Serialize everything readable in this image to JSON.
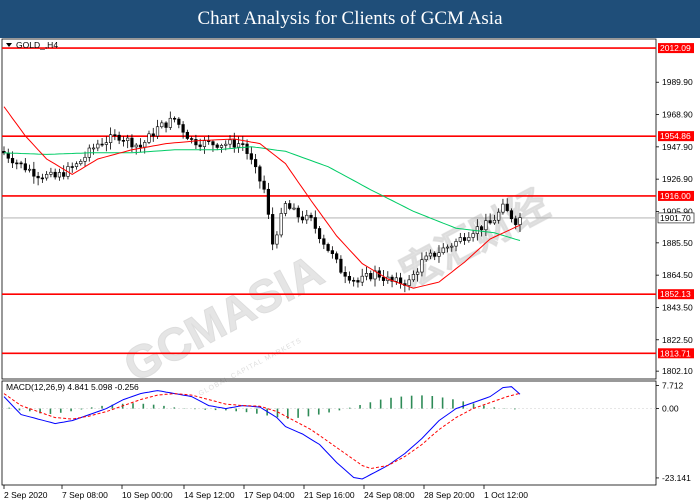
{
  "header": {
    "title": "Chart Analysis for Clients of GCM Asia"
  },
  "watermark": {
    "text": "GCMASIA",
    "chinese": "宏汇财经",
    "subtitle": "GLOBAL CAPITAL MARKETS"
  },
  "colors": {
    "header_bg": "#1f4e79",
    "level_line": "#ff0000",
    "current_price_line": "#a9a9a9",
    "ma_fast": "#ff0000",
    "ma_slow": "#00cc66",
    "macd_line": "#0000ff",
    "signal_line": "#ff0000",
    "histogram": "#2e8b57",
    "candle_outline": "#000000",
    "bull_candle": "#ffffff",
    "bear_candle": "#000000"
  },
  "chart_data": {
    "type": "candlestick",
    "symbol_label": "GOLD_,H4",
    "y_ticks": [
      "1989.90",
      "1968.90",
      "1947.90",
      "1926.90",
      "1905.90",
      "1885.50",
      "1864.50",
      "1843.50",
      "1822.50",
      "1802.10"
    ],
    "x_ticks": [
      "2 Sep 2020",
      "7 Sep 08:00",
      "10 Sep 00:00",
      "14 Sep 12:00",
      "17 Sep 04:00",
      "21 Sep 16:00",
      "24 Sep 08:00",
      "28 Sep 20:00",
      "1 Oct 12:00"
    ],
    "ylim": [
      1797,
      2018
    ],
    "levels": [
      {
        "label": "2012.09",
        "value": 2012.09
      },
      {
        "label": "1954.86",
        "value": 1954.86
      },
      {
        "label": "1916.00",
        "value": 1916.0
      },
      {
        "label": "1852.13",
        "value": 1852.13
      },
      {
        "label": "1813.71",
        "value": 1813.71
      }
    ],
    "current_price": {
      "label": "1901.70",
      "value": 1901.7
    },
    "close_path": [
      [
        0,
        1944
      ],
      [
        4,
        1936
      ],
      [
        8,
        1930
      ],
      [
        12,
        1928
      ],
      [
        17,
        1936
      ],
      [
        22,
        1950
      ],
      [
        27,
        1955
      ],
      [
        32,
        1948
      ],
      [
        36,
        1960
      ],
      [
        40,
        1966
      ],
      [
        44,
        1952
      ],
      [
        48,
        1950
      ],
      [
        52,
        1950
      ],
      [
        56,
        1950
      ],
      [
        61,
        1920
      ],
      [
        63,
        1885
      ],
      [
        66,
        1910
      ],
      [
        69,
        1903
      ],
      [
        72,
        1900
      ],
      [
        75,
        1886
      ],
      [
        79,
        1868
      ],
      [
        83,
        1860
      ],
      [
        87,
        1866
      ],
      [
        91,
        1860
      ],
      [
        95,
        1860
      ],
      [
        98,
        1873
      ],
      [
        102,
        1880
      ],
      [
        106,
        1886
      ],
      [
        110,
        1894
      ],
      [
        114,
        1898
      ],
      [
        117,
        1908
      ],
      [
        120,
        1900
      ],
      [
        121,
        1901.7
      ]
    ],
    "ma_slow_path": [
      [
        0,
        1944
      ],
      [
        10,
        1943
      ],
      [
        20,
        1944
      ],
      [
        30,
        1944
      ],
      [
        40,
        1946
      ],
      [
        50,
        1946
      ],
      [
        58,
        1948
      ],
      [
        66,
        1945
      ],
      [
        76,
        1935
      ],
      [
        86,
        1920
      ],
      [
        96,
        1906
      ],
      [
        106,
        1895
      ],
      [
        115,
        1892
      ],
      [
        121,
        1887
      ]
    ],
    "ma_fast_path": [
      [
        0,
        1974
      ],
      [
        5,
        1955
      ],
      [
        10,
        1940
      ],
      [
        16,
        1930
      ],
      [
        22,
        1940
      ],
      [
        30,
        1946
      ],
      [
        38,
        1950
      ],
      [
        46,
        1952
      ],
      [
        54,
        1953
      ],
      [
        60,
        1950
      ],
      [
        66,
        1937
      ],
      [
        72,
        1913
      ],
      [
        78,
        1890
      ],
      [
        84,
        1872
      ],
      [
        90,
        1862
      ],
      [
        96,
        1856
      ],
      [
        102,
        1860
      ],
      [
        108,
        1873
      ],
      [
        114,
        1888
      ],
      [
        121,
        1897
      ]
    ],
    "macd": {
      "label": "MACD(12,26,9) 4.841 5.098 -0.256",
      "y_ticks": [
        "7.712",
        "0.00",
        "-23.141"
      ],
      "ylim": [
        -25.5,
        9.2
      ],
      "macd_path": [
        [
          0,
          4
        ],
        [
          4,
          -2
        ],
        [
          8,
          -3.5
        ],
        [
          12,
          -5
        ],
        [
          16,
          -4
        ],
        [
          20,
          -2
        ],
        [
          24,
          0
        ],
        [
          28,
          3
        ],
        [
          32,
          5
        ],
        [
          36,
          6
        ],
        [
          40,
          5
        ],
        [
          44,
          4
        ],
        [
          48,
          1
        ],
        [
          52,
          0
        ],
        [
          56,
          1
        ],
        [
          60,
          0.5
        ],
        [
          64,
          -3
        ],
        [
          66,
          -6
        ],
        [
          70,
          -8.5
        ],
        [
          74,
          -12
        ],
        [
          78,
          -18
        ],
        [
          82,
          -23
        ],
        [
          84,
          -23.5
        ],
        [
          86,
          -22
        ],
        [
          90,
          -19
        ],
        [
          94,
          -15
        ],
        [
          98,
          -10
        ],
        [
          102,
          -4
        ],
        [
          106,
          0
        ],
        [
          110,
          2
        ],
        [
          114,
          4
        ],
        [
          117,
          7
        ],
        [
          119,
          7.3
        ],
        [
          121,
          4.8
        ]
      ],
      "signal_path": [
        [
          0,
          5
        ],
        [
          4,
          1
        ],
        [
          8,
          -1
        ],
        [
          12,
          -3
        ],
        [
          16,
          -3.5
        ],
        [
          20,
          -2.5
        ],
        [
          24,
          -1
        ],
        [
          28,
          1
        ],
        [
          32,
          3
        ],
        [
          36,
          4.5
        ],
        [
          40,
          5
        ],
        [
          44,
          4.5
        ],
        [
          48,
          3
        ],
        [
          52,
          1.5
        ],
        [
          56,
          1
        ],
        [
          60,
          0.8
        ],
        [
          64,
          -1
        ],
        [
          68,
          -4
        ],
        [
          72,
          -7
        ],
        [
          76,
          -11
        ],
        [
          80,
          -15
        ],
        [
          84,
          -19
        ],
        [
          86,
          -20
        ],
        [
          90,
          -19
        ],
        [
          94,
          -16
        ],
        [
          98,
          -12
        ],
        [
          102,
          -7
        ],
        [
          106,
          -3
        ],
        [
          110,
          0
        ],
        [
          114,
          2
        ],
        [
          118,
          4
        ],
        [
          121,
          5.1
        ]
      ],
      "histogram": [
        0.3,
        -0.6,
        -0.9,
        -1.6,
        -1.8,
        -1.4,
        -0.9,
        -0.3,
        0.4,
        0.9,
        1.3,
        1.6,
        1.8,
        1.6,
        1.3,
        0.9,
        0.4,
        0.1,
        -0.2,
        -0.4,
        -0.5,
        -0.6,
        -0.9,
        -1.2,
        -1.7,
        -2.3,
        -2.9,
        -3.4,
        -3.1,
        -2.6,
        -2.0,
        -1.3,
        -0.6,
        0.3,
        1.2,
        2.1,
        3.0,
        3.6,
        4.0,
        4.3,
        4.4,
        4.2,
        3.7,
        3.1,
        2.4,
        1.7,
        1.0,
        0.4,
        -0.1,
        -0.26
      ]
    }
  }
}
